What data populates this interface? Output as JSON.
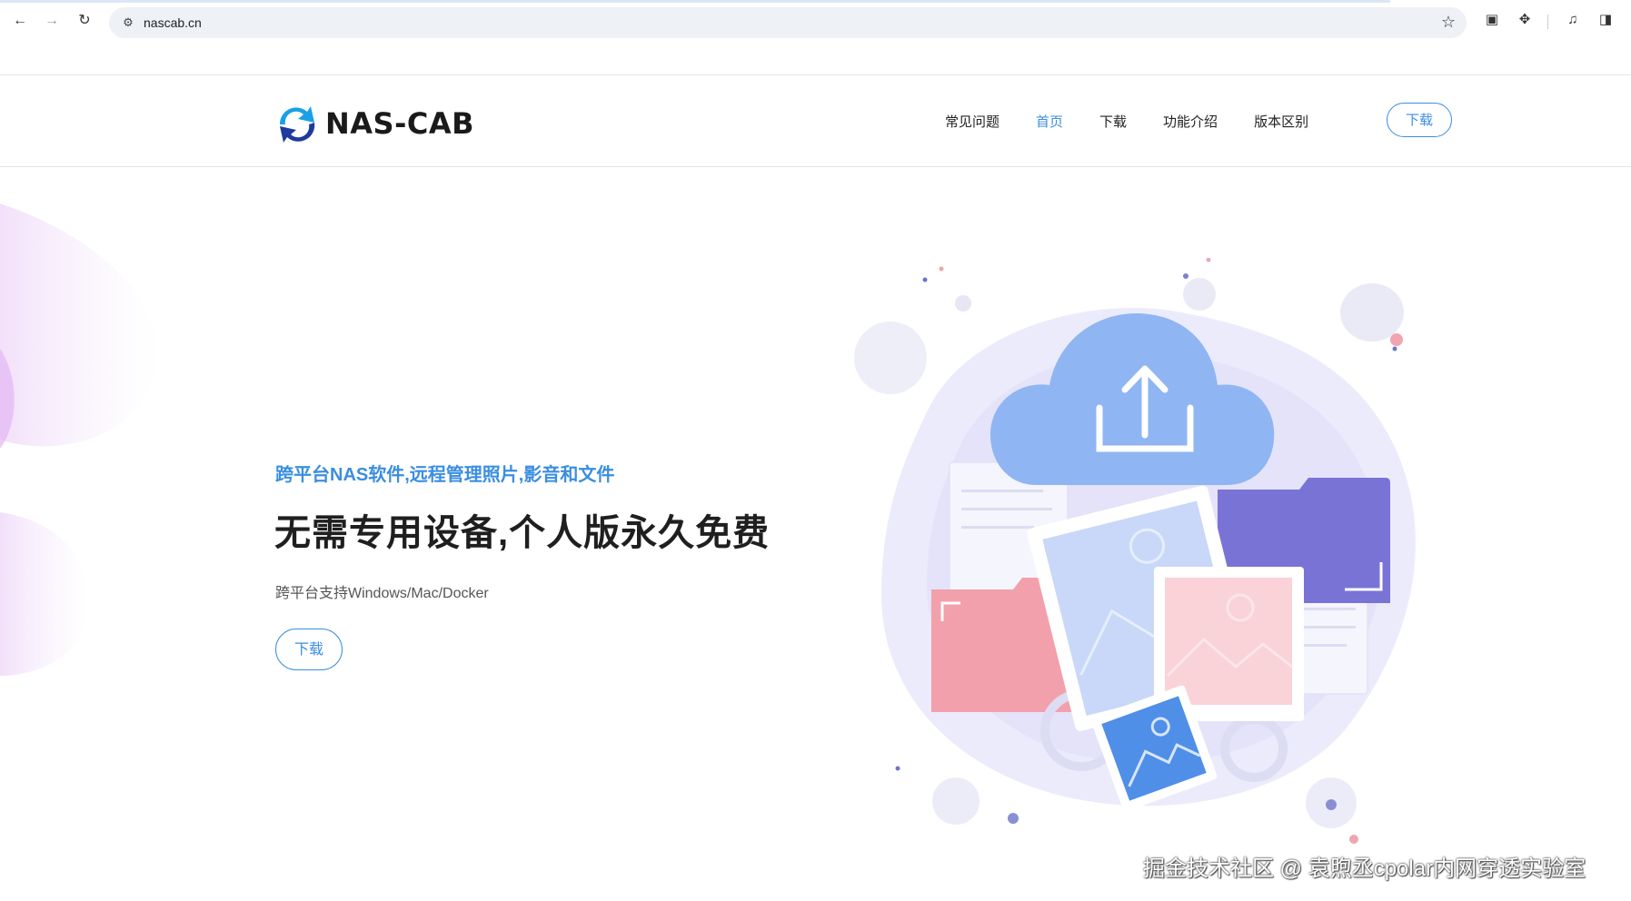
{
  "browser": {
    "url": "nascab.cn",
    "icons": [
      "back-icon",
      "forward-icon",
      "reload-icon",
      "site-info-icon",
      "star-icon",
      "reading-mode-icon",
      "extensions-icon",
      "media-icon",
      "side-panel-icon"
    ]
  },
  "header": {
    "logo_text": "NAS-CAB",
    "nav": [
      "常见问题",
      "首页",
      "下载",
      "功能介绍",
      "版本区别"
    ],
    "active_nav": "首页",
    "download_label": "下载"
  },
  "hero": {
    "tagline": "跨平台NAS软件,远程管理照片,影音和文件",
    "title": "无需专用设备,个人版永久免费",
    "subtitle": "跨平台支持Windows/Mac/Docker",
    "download_label": "下载"
  },
  "watermark": "掘金技术社区 @ 袁煦丞cpolar内网穿透实验室",
  "colors": {
    "accent": "#3b8ee0",
    "cloud": "#8fb6f2",
    "folder_purple": "#7a73d6",
    "folder_pink": "#f2a0ac",
    "blob": "#e9e8fb"
  }
}
